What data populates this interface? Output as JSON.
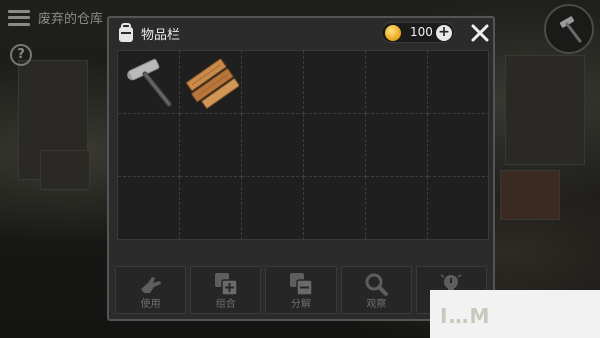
{
  "hud": {
    "location": "废弃的仓库",
    "help_symbol": "?"
  },
  "inventory": {
    "title": "物品栏",
    "coins": "100",
    "add_symbol": "+",
    "slots": [
      {
        "item": "hammer"
      },
      {
        "item": "wooden-planks"
      },
      {
        "item": ""
      },
      {
        "item": ""
      },
      {
        "item": ""
      },
      {
        "item": ""
      },
      {
        "item": ""
      },
      {
        "item": ""
      },
      {
        "item": ""
      },
      {
        "item": ""
      },
      {
        "item": ""
      },
      {
        "item": ""
      },
      {
        "item": ""
      },
      {
        "item": ""
      },
      {
        "item": ""
      },
      {
        "item": ""
      },
      {
        "item": ""
      },
      {
        "item": ""
      }
    ],
    "actions": [
      {
        "label": "使用",
        "icon": "hand-icon"
      },
      {
        "label": "组合",
        "icon": "combine-icon"
      },
      {
        "label": "分解",
        "icon": "split-icon"
      },
      {
        "label": "观察",
        "icon": "magnifier-icon"
      },
      {
        "label": "",
        "icon": "lightbulb-icon"
      }
    ]
  },
  "watermark": {
    "text": "I…M"
  }
}
